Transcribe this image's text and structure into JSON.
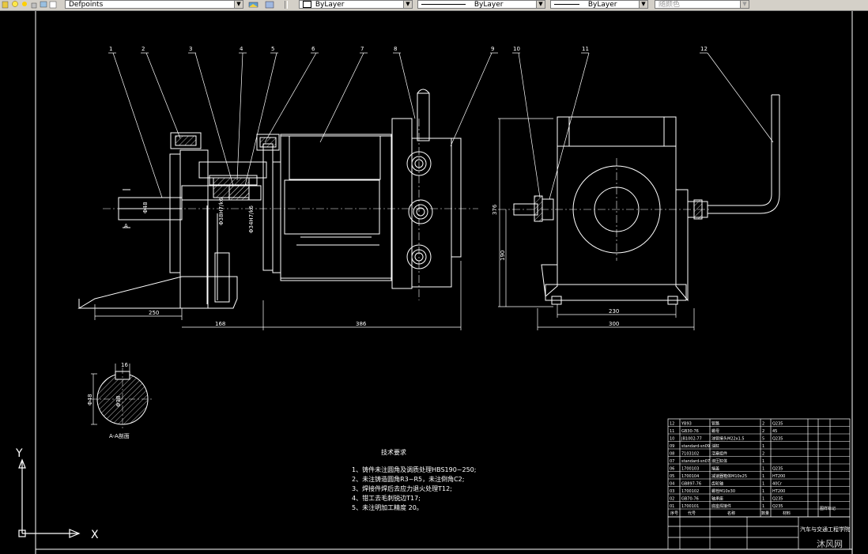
{
  "toolbar": {
    "layer_name": "Defpoints",
    "color_value": "ByLayer",
    "linetype_value": "ByLayer",
    "lineweight_value": "ByLayer",
    "plotstyle_value": "随颜色"
  },
  "balloons": [
    "1",
    "2",
    "3",
    "4",
    "5",
    "6",
    "7",
    "8",
    "9",
    "10",
    "11",
    "12"
  ],
  "dimensions": {
    "d250": "250",
    "d168": "168",
    "d386": "386",
    "d230": "230",
    "d300": "300",
    "d376": "376",
    "d190": "190",
    "d48": "Φ48",
    "d16": "16",
    "d48b": "Φ48",
    "d38": "Φ38"
  },
  "fit_labels": [
    "Φ38H7/k6",
    "Φ34H7/k6"
  ],
  "section": {
    "label": "A-A剖面",
    "cut_mark": "A"
  },
  "tech_requirements": {
    "title": "技术要求",
    "items": [
      "1、铸件未注圆角及调质处理HBS190~250;",
      "2、未注铸造圆角R3~R5，未注倒角C2;",
      "3、焊接件焊后去应力退火处理T12;",
      "4、钳工去毛刺锐边T17;",
      "5、未注明加工精度 20。"
    ]
  },
  "bom": {
    "rows": [
      {
        "no": "12",
        "code": "YB93",
        "name": "管路",
        "qty": "2",
        "mat": "Q235"
      },
      {
        "no": "11",
        "code": "GB30-76",
        "name": "螺母",
        "qty": "2",
        "mat": "45"
      },
      {
        "no": "10",
        "code": "JB1002-77",
        "name": "油管接头M22x1.5",
        "qty": "5",
        "mat": "Q235"
      },
      {
        "no": "09",
        "code": "standard-sn09",
        "name": "油缸",
        "qty": "1",
        "mat": ""
      },
      {
        "no": "08",
        "code": "7103102",
        "name": "活塞组件",
        "qty": "2",
        "mat": ""
      },
      {
        "no": "07",
        "code": "standard-sn07",
        "name": "液压缸体",
        "qty": "1",
        "mat": ""
      },
      {
        "no": "06",
        "code": "1700103",
        "name": "端盖",
        "qty": "1",
        "mat": "Q235"
      },
      {
        "no": "05",
        "code": "1700104",
        "name": "减速器箱体M10x25",
        "qty": "1",
        "mat": "HT200"
      },
      {
        "no": "04",
        "code": "GB897-76",
        "name": "齿轮轴",
        "qty": "1",
        "mat": "40Cr"
      },
      {
        "no": "03",
        "code": "1700102",
        "name": "螺栓M10x30",
        "qty": "1",
        "mat": "HT200"
      },
      {
        "no": "02",
        "code": "GB70-76",
        "name": "轴承座",
        "qty": "1",
        "mat": "Q235"
      },
      {
        "no": "01",
        "code": "1700101",
        "name": "底座焊接件",
        "qty": "1",
        "mat": "Q235"
      }
    ],
    "header": [
      "序号",
      "代号",
      "名称",
      "数量",
      "材料"
    ],
    "school": "汽车与交通工程学院",
    "corner_stamp": "图样标记",
    "watermark": "沐风网"
  },
  "ucs": {
    "x": "X",
    "y": "Y"
  }
}
